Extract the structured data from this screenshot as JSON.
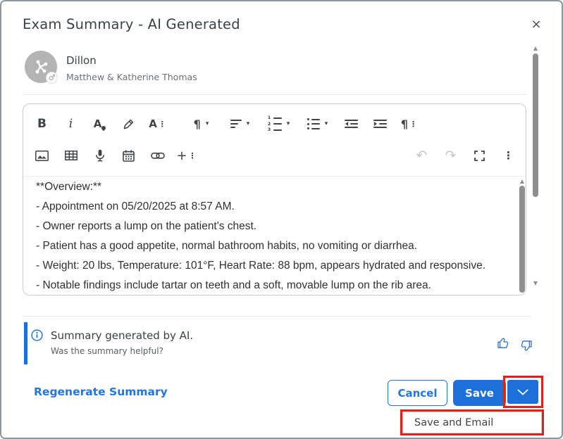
{
  "modal": {
    "title": "Exam Summary - AI Generated"
  },
  "patient": {
    "name": "Dillon",
    "owners": "Matthew & Katherine Thomas"
  },
  "editor": {
    "content_lines": [
      "**Overview:**",
      "- Appointment on 05/20/2025 at 8:57 AM.",
      "- Owner reports a lump on the patient's chest.",
      "- Patient has a good appetite, normal bathroom habits, no vomiting or diarrhea.",
      "- Weight: 20 lbs, Temperature: 101°F, Heart Rate: 88 bpm, appears hydrated and responsive.",
      "- Notable findings include tartar on teeth and a soft, movable lump on the rib area."
    ],
    "toolbar_row1": [
      "bold",
      "italic",
      "text-color",
      "highlight",
      "more-text",
      "paragraph-format",
      "align",
      "ordered-list",
      "unordered-list",
      "outdent",
      "indent",
      "more-paragraph"
    ],
    "toolbar_row2": [
      "insert-image",
      "insert-table",
      "record-audio",
      "insert-date",
      "insert-link",
      "more-rich",
      "undo",
      "redo",
      "fullscreen",
      "more-misc"
    ]
  },
  "icons": {
    "close": "×",
    "bold": "B",
    "italic": "i",
    "letter_a": "A",
    "paragraph": "¶",
    "caret": "▾",
    "kebab": "⋮",
    "plus": "+",
    "undo": "↶",
    "redo": "↷",
    "male": "♂",
    "scroll_up": "▲",
    "scroll_down": "▼",
    "ol_numbers": {
      "n1": "1",
      "n2": "2",
      "n3": "3"
    }
  },
  "ai_banner": {
    "message": "Summary generated by AI.",
    "question": "Was the summary helpful?"
  },
  "footer": {
    "regenerate_label": "Regenerate Summary",
    "cancel_label": "Cancel",
    "save_label": "Save",
    "menu_item_label": "Save and Email"
  },
  "colors": {
    "accent_blue": "#1d70d9",
    "link_blue": "#2276e3",
    "annotation_red": "#df231c",
    "avatar_gray": "#b4b4b4"
  }
}
